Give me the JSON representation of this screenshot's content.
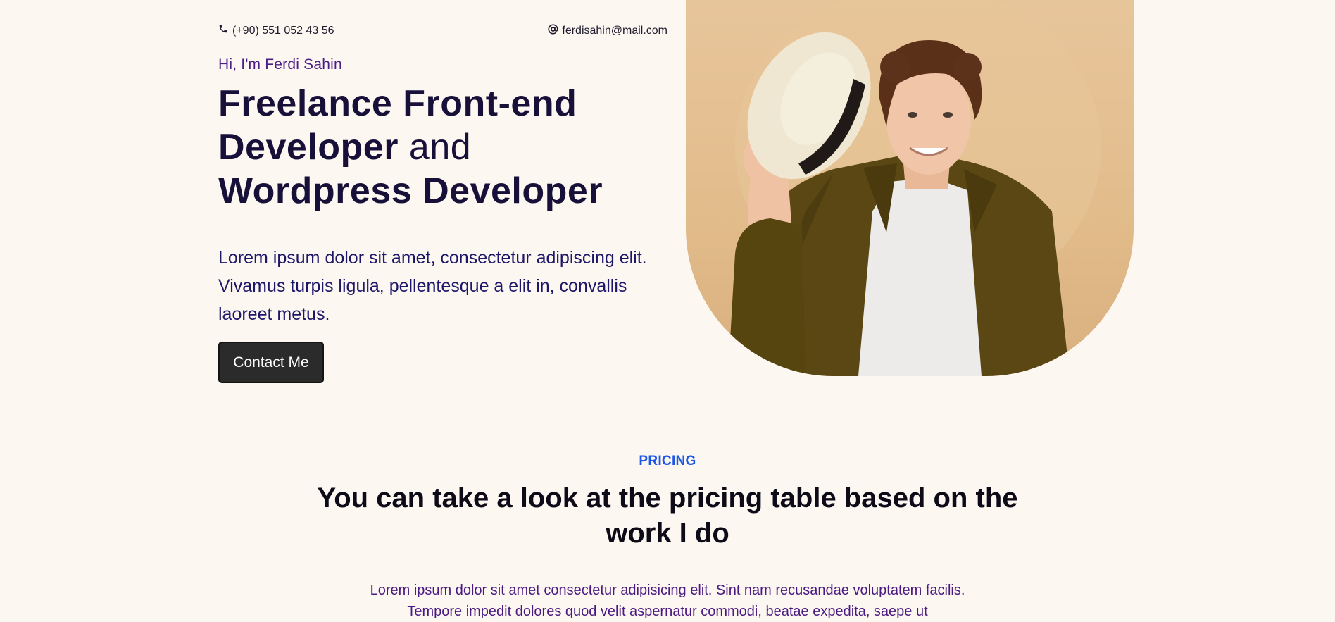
{
  "contact": {
    "phone": "(+90) 551 052 43 56",
    "email": "ferdisahin@mail.com"
  },
  "hero": {
    "greeting": "Hi, I'm Ferdi Sahin",
    "headline_bold_1": "Freelance Front-end Developer",
    "headline_light": "and",
    "headline_bold_2": "Wordpress Developer",
    "intro": "Lorem ipsum dolor sit amet, consectetur adipiscing elit. Vivamus turpis ligula, pellentesque a elit in, convallis laoreet metus.",
    "cta_label": "Contact Me"
  },
  "pricing": {
    "label": "PRICING",
    "title": "You can take a look at the pricing table based on the work I do",
    "description": "Lorem ipsum dolor sit amet consectetur adipisicing elit. Sint nam recusandae voluptatem facilis. Tempore impedit dolores quod velit aspernatur commodi, beatae expedita, saepe ut"
  },
  "icons": {
    "phone": "phone-icon",
    "email": "at-sign-icon"
  },
  "colors": {
    "background": "#fdf7f1",
    "headline": "#17113a",
    "greeting": "#4b1e86",
    "intro": "#1d1769",
    "accent": "#1c57e8",
    "button": "#2b2b2b",
    "photo_bg": "#e2bb8a"
  }
}
